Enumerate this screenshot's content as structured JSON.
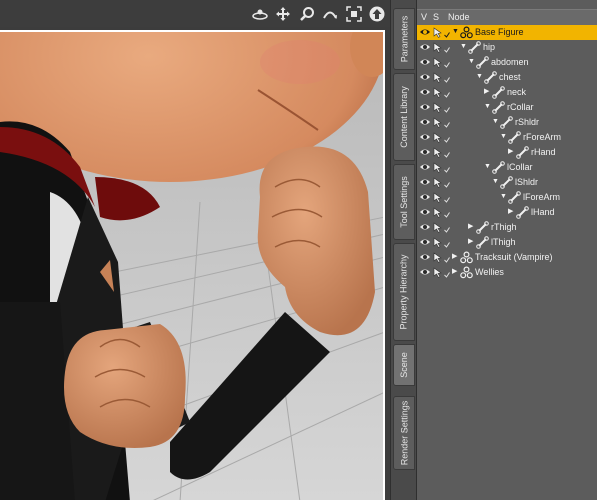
{
  "toolbar": {
    "icons": [
      "walk-icon",
      "move-icon",
      "zoom-icon",
      "orbit-icon",
      "frame-icon",
      "home-icon"
    ]
  },
  "tabs": [
    "Parameters",
    "Content Library",
    "Tool Settings",
    "Property Hierarchy",
    "Scene",
    "Render Settings"
  ],
  "active_tab": "Scene",
  "scene": {
    "columns": {
      "visible": "V",
      "selectable": "S",
      "node": "Node"
    },
    "nodes": [
      {
        "label": "Base Figure",
        "depth": 0,
        "expanded": true,
        "type": "figure",
        "selected": true
      },
      {
        "label": "hip",
        "depth": 1,
        "expanded": true,
        "type": "bone"
      },
      {
        "label": "abdomen",
        "depth": 2,
        "expanded": true,
        "type": "bone"
      },
      {
        "label": "chest",
        "depth": 3,
        "expanded": true,
        "type": "bone"
      },
      {
        "label": "neck",
        "depth": 4,
        "expanded": false,
        "type": "bone"
      },
      {
        "label": "rCollar",
        "depth": 4,
        "expanded": true,
        "type": "bone"
      },
      {
        "label": "rShldr",
        "depth": 5,
        "expanded": true,
        "type": "bone"
      },
      {
        "label": "rForeArm",
        "depth": 6,
        "expanded": true,
        "type": "bone"
      },
      {
        "label": "rHand",
        "depth": 7,
        "expanded": false,
        "type": "bone"
      },
      {
        "label": "lCollar",
        "depth": 4,
        "expanded": true,
        "type": "bone"
      },
      {
        "label": "lShldr",
        "depth": 5,
        "expanded": true,
        "type": "bone"
      },
      {
        "label": "lForeArm",
        "depth": 6,
        "expanded": true,
        "type": "bone"
      },
      {
        "label": "lHand",
        "depth": 7,
        "expanded": false,
        "type": "bone"
      },
      {
        "label": "rThigh",
        "depth": 2,
        "expanded": false,
        "type": "bone"
      },
      {
        "label": "lThigh",
        "depth": 2,
        "expanded": false,
        "type": "bone"
      },
      {
        "label": "Tracksuit (Vampire)",
        "depth": 0,
        "expanded": false,
        "type": "figure"
      },
      {
        "label": "Wellies",
        "depth": 0,
        "expanded": false,
        "type": "figure"
      }
    ]
  },
  "colors": {
    "selection": "#f2b400",
    "panel": "#5c5c5c",
    "viewport_border": "#ffffff"
  }
}
